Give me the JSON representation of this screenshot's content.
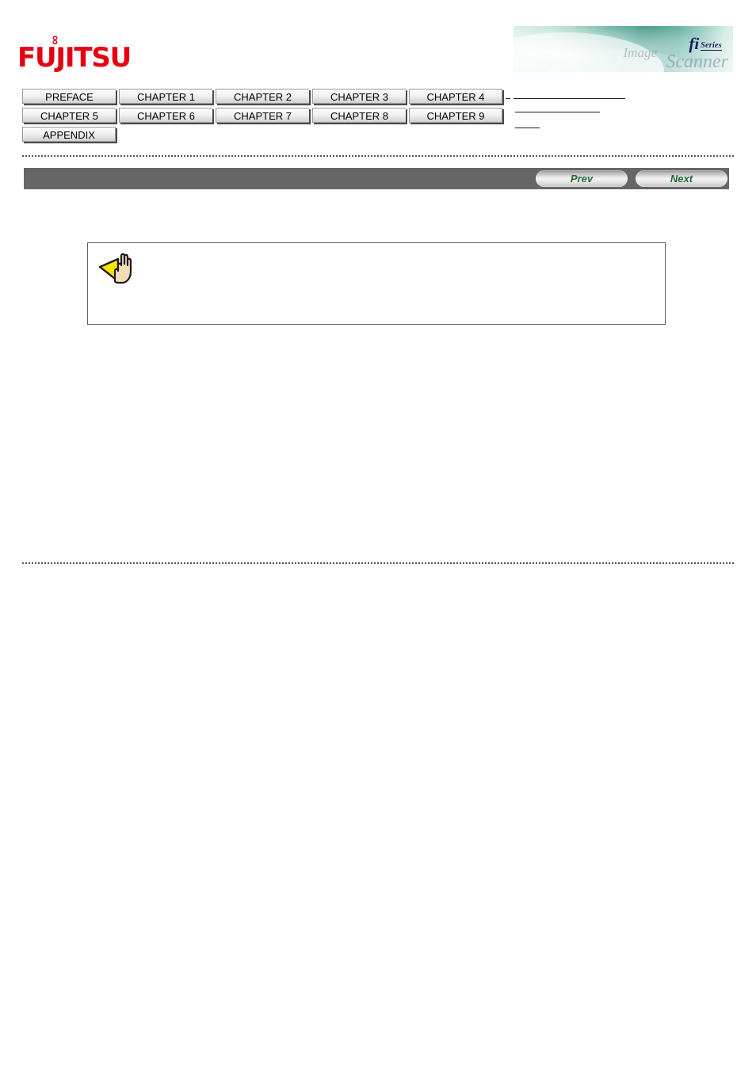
{
  "header": {
    "logo_text": "FUJITSU",
    "logo_infinity_glyph": "∞",
    "logo_color": "#e60012",
    "banner": {
      "fi_text": "fi",
      "series_text": "Series",
      "image_word": "Image",
      "scanner_word": "Scanner",
      "accent_color": "#2e8c7c",
      "text_color": "#141b5c"
    }
  },
  "nav": {
    "rows": [
      [
        {
          "label": "PREFACE"
        },
        {
          "label": "CHAPTER 1"
        },
        {
          "label": "CHAPTER 2"
        },
        {
          "label": "CHAPTER 3"
        },
        {
          "label": "CHAPTER 4"
        }
      ],
      [
        {
          "label": "CHAPTER 5"
        },
        {
          "label": "CHAPTER 6"
        },
        {
          "label": "CHAPTER 7"
        },
        {
          "label": "CHAPTER 8"
        },
        {
          "label": "CHAPTER 9"
        }
      ],
      [
        {
          "label": "APPENDIX"
        }
      ]
    ]
  },
  "toolbar": {
    "prev_label": "Prev",
    "next_label": "Next",
    "bar_color": "#666666",
    "button_text_color": "#1f6b32"
  },
  "note": {
    "icon": "hand-attention-icon",
    "icon_arrow_color": "#f5e400",
    "icon_hand_color": "#f2dcb8",
    "text": ""
  },
  "main": {
    "text": ""
  }
}
